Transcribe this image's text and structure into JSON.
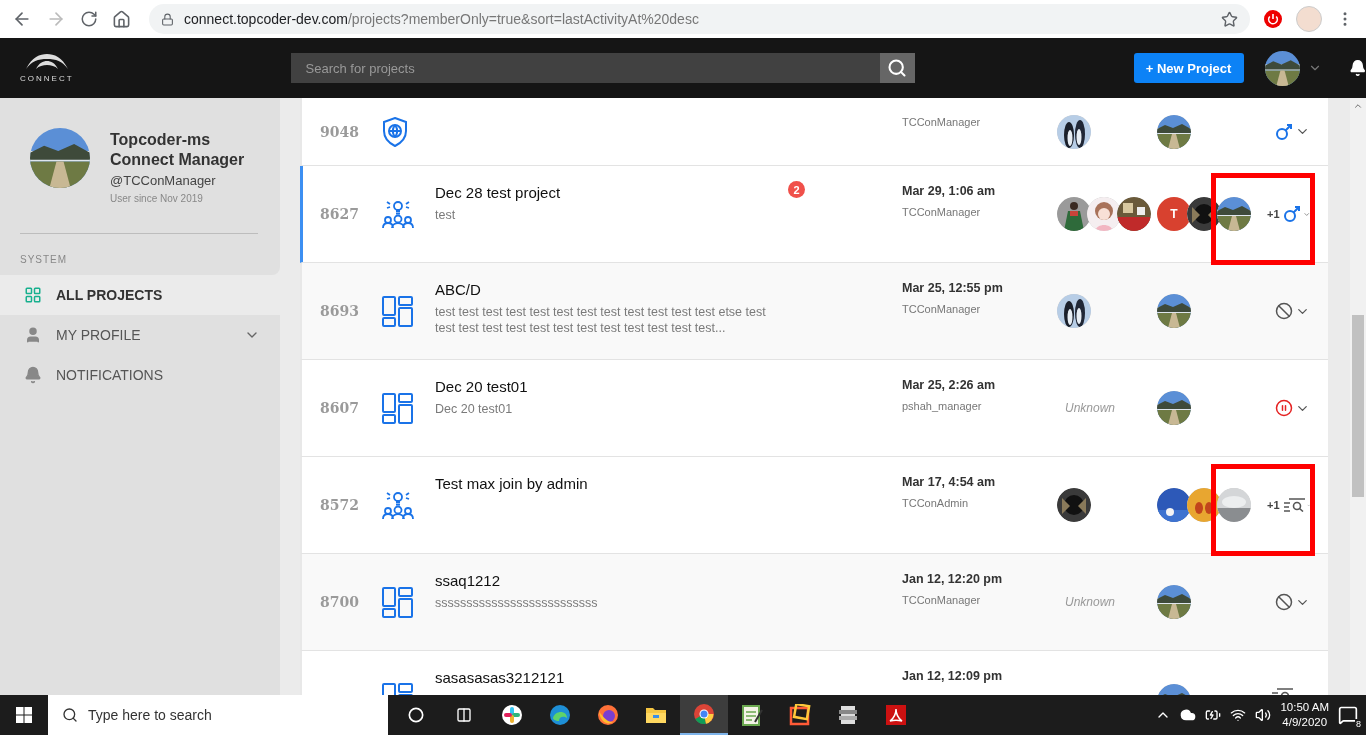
{
  "browser": {
    "url_host": "connect.topcoder-dev.com",
    "url_path": "/projects?memberOnly=true&sort=lastActivityAt%20desc",
    "forward_disabled": true
  },
  "header": {
    "logo_text": "CONNECT",
    "search": {
      "placeholder": "Search for projects"
    },
    "new_project_button": "+ New Project"
  },
  "sidebar": {
    "user": {
      "name": "Topcoder-ms Connect Manager",
      "handle": "@TCConManager",
      "since": "User since Nov 2019"
    },
    "section_label": "SYSTEM",
    "items": [
      {
        "kind": "grid",
        "label": "ALL PROJECTS",
        "selected": true,
        "expandable": false
      },
      {
        "kind": "user",
        "label": "MY PROFILE",
        "selected": false,
        "expandable": true
      },
      {
        "kind": "bell",
        "label": "NOTIFICATIONS",
        "selected": false,
        "expandable": false
      }
    ]
  },
  "projects": [
    {
      "id": "9048",
      "icon": {
        "kind": "shield"
      },
      "owner": "TCConManager",
      "customers": [
        {
          "kind": "picture"
        }
      ],
      "managers": [
        {
          "kind": "picture"
        }
      ],
      "status": {
        "kind": "active"
      },
      "selected": false,
      "highlighted": false
    },
    {
      "id": "8627",
      "icon": {
        "kind": "idea"
      },
      "title": "Dec 28 test project",
      "description": "test",
      "unread": "2",
      "date": "Mar 29, 1:06 am",
      "owner": "TCConManager",
      "customers": [
        {
          "kind": "picture"
        },
        {
          "kind": "picture"
        },
        {
          "kind": "picture"
        }
      ],
      "managers": [
        {
          "kind": "letter",
          "text": "T",
          "color": "#d8412f"
        },
        {
          "kind": "picture"
        },
        {
          "kind": "picture"
        }
      ],
      "more": "+1",
      "status": {
        "kind": "active"
      },
      "selected": true,
      "highlighted": true
    },
    {
      "id": "8693",
      "icon": {
        "kind": "grid"
      },
      "title": "ABC/D",
      "description": "test test test test test test test test test test test test etse test test test test test test test test test test test test test...",
      "date": "Mar 25, 12:55 pm",
      "owner": "TCConManager",
      "customers": [
        {
          "kind": "picture"
        }
      ],
      "managers": [
        {
          "kind": "picture"
        }
      ],
      "status": {
        "kind": "cancelled"
      },
      "selected": false,
      "highlighted": false
    },
    {
      "id": "8607",
      "icon": {
        "kind": "grid"
      },
      "title": "Dec 20 test01",
      "description": "Dec 20 test01",
      "date": "Mar 25, 2:26 am",
      "owner": "pshah_manager",
      "customer_text": "Unknown",
      "managers": [
        {
          "kind": "picture"
        }
      ],
      "status": {
        "kind": "paused"
      },
      "selected": false,
      "highlighted": false
    },
    {
      "id": "8572",
      "icon": {
        "kind": "idea"
      },
      "title": "Test max join by admin",
      "date": "Mar 17, 4:54 am",
      "owner": "TCConAdmin",
      "customers": [
        {
          "kind": "picture"
        }
      ],
      "managers": [
        {
          "kind": "picture"
        },
        {
          "kind": "picture"
        },
        {
          "kind": "picture"
        }
      ],
      "more": "+1",
      "status": {
        "kind": "reviewed"
      },
      "selected": false,
      "highlighted": true
    },
    {
      "id": "8700",
      "icon": {
        "kind": "grid"
      },
      "title": "ssaq1212",
      "description": "ssssssssssssssssssssssssss",
      "date": "Jan 12, 12:20 pm",
      "owner": "TCConManager",
      "customer_text": "Unknown",
      "managers": [
        {
          "kind": "picture"
        }
      ],
      "status": {
        "kind": "cancelled"
      },
      "selected": false,
      "highlighted": false
    },
    {
      "icon": {
        "kind": "grid"
      },
      "title": "sasasasas3212121",
      "date": "Jan 12, 12:09 pm",
      "managers": [
        {
          "kind": "picture"
        }
      ],
      "status": {
        "kind": "reviewed"
      },
      "selected": false,
      "highlighted": false
    }
  ],
  "taskbar": {
    "search_placeholder": "Type here to search",
    "apps": [
      {
        "kind": "pinwheel",
        "active": false
      },
      {
        "kind": "wave",
        "active": false
      },
      {
        "kind": "fox",
        "active": false
      },
      {
        "kind": "folder",
        "active": false
      },
      {
        "kind": "browser",
        "active": true
      },
      {
        "kind": "notepad",
        "active": false
      },
      {
        "kind": "frame",
        "active": false
      },
      {
        "kind": "stack",
        "active": false
      },
      {
        "kind": "pdf",
        "active": false
      }
    ],
    "time": "10:50 AM",
    "date": "4/9/2020",
    "notifications": "8"
  }
}
